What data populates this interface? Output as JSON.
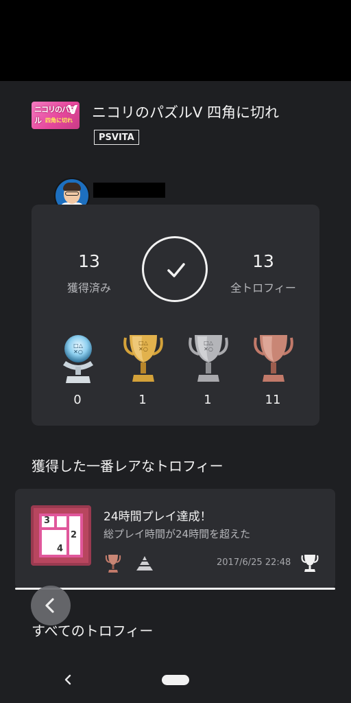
{
  "game": {
    "title": "ニコリのパズルV 四角に切れ",
    "platform": "PSVITA",
    "icon_text_top": "ニコリのパズル",
    "icon_text_sub": "四角に切れ",
    "icon_text_v": "V"
  },
  "stats": {
    "earned_count": "13",
    "earned_label": "獲得済み",
    "total_count": "13",
    "total_label": "全トロフィー",
    "completion": 1.0
  },
  "trophy_counts": {
    "platinum": "0",
    "gold": "1",
    "silver": "1",
    "bronze": "11"
  },
  "rarest_section": {
    "title": "獲得した一番レアなトロフィー",
    "trophy": {
      "name": "24時間プレイ達成！",
      "description": "総プレイ時間が24時間を超えた",
      "date": "2017/6/25  22:48",
      "grade": "bronze",
      "image_numbers": [
        "3",
        "2",
        "4"
      ]
    }
  },
  "all_trophies_section": {
    "title": "すべてのトロフィー"
  },
  "icons": {
    "check": "check-icon",
    "back": "chevron-left-icon",
    "rarity": "pyramid-icon",
    "trophy": "trophy-icon"
  },
  "colors": {
    "background": "#1e1f22",
    "card": "#2c2d31",
    "platinum": "#8fd0f0",
    "gold": "#d4a23a",
    "silver": "#a9a9ad",
    "bronze": "#c27a6a"
  }
}
